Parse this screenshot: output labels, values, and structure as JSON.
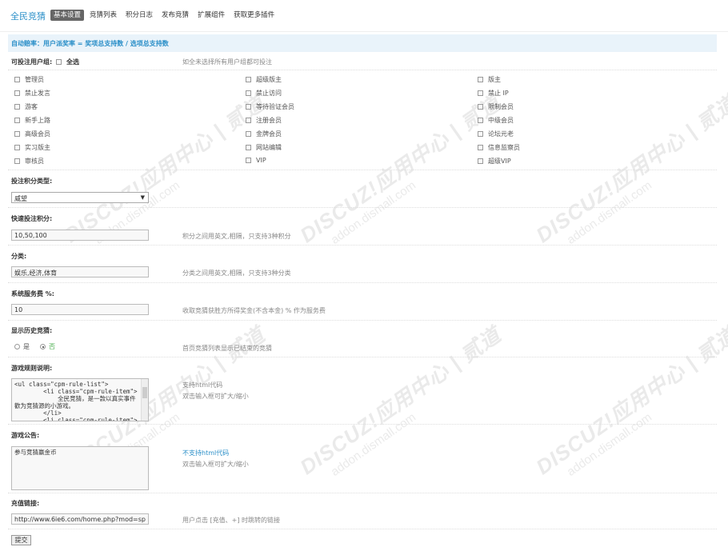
{
  "header": {
    "brand": "全民竞猜",
    "tabs": [
      {
        "label": "基本设置",
        "active": true
      },
      {
        "label": "竞猜列表"
      },
      {
        "label": "积分日志"
      },
      {
        "label": "发布竞猜"
      },
      {
        "label": "扩展组件"
      },
      {
        "label": "获取更多插件"
      }
    ]
  },
  "notice": "自动赔率：用户派奖率 = 奖项总支持数 / 选项总支持数",
  "groups": {
    "label": "可投注用户组:",
    "all_label": "全选",
    "hint": "如全未选择所有用户组都可投注",
    "col1": [
      "管理员",
      "禁止发言",
      "游客",
      "新手上路",
      "高级会员",
      "实习版主",
      "审核员"
    ],
    "col2": [
      "超级版主",
      "禁止访问",
      "等待验证会员",
      "注册会员",
      "金牌会员",
      "网站编辑",
      "VIP"
    ],
    "col3": [
      "版主",
      "禁止 IP",
      "限制会员",
      "中级会员",
      "论坛元老",
      "信息监察员",
      "超级VIP"
    ]
  },
  "credit_type": {
    "label": "投注积分类型:",
    "value": "威望"
  },
  "quick_credits": {
    "label": "快速投注积分:",
    "value": "10,50,100",
    "hint": "积分之间用英文,相隔，只支持3种积分"
  },
  "category": {
    "label": "分类:",
    "value": "娱乐,经济,体育",
    "hint": "分类之间用英文,相隔，只支持3种分类"
  },
  "service_fee": {
    "label": "系统服务费 %:",
    "value": "10",
    "hint": "收取竞猜获胜方所得奖金(不含本金) % 作为服务费"
  },
  "history": {
    "label": "显示历史竞猜:",
    "yes": "是",
    "no": "否",
    "hint": "首页竞猜列表显示已结束的竞猜"
  },
  "rules": {
    "label": "游戏规则说明:",
    "value": "<ul class=\"cpm-rule-list\">\n        <li class=\"cpm-rule-item\">\n            全民竞猜，是一款以真实事件\n歡为竞猜源的小游戏。\n        </li>\n        <li class=\"cpm-rule-item\">",
    "hint1": "支持html代码",
    "hint2": "双击输入框可扩大/缩小"
  },
  "announcement": {
    "label": "游戏公告:",
    "value": "参与竞猜赢金币",
    "hint1": "不支持html代码",
    "hint2": "双击输入框可扩大/缩小"
  },
  "recharge": {
    "label": "充值链接:",
    "value": "http://www.6ie6.com/home.php?mod=sp",
    "hint": "用户点击 [充值、+] 时跳转的链接"
  },
  "submit_label": "提交",
  "watermark": {
    "text": "DISCUZ!应用中心 | 贰道",
    "url": "addon.dismall.com"
  }
}
